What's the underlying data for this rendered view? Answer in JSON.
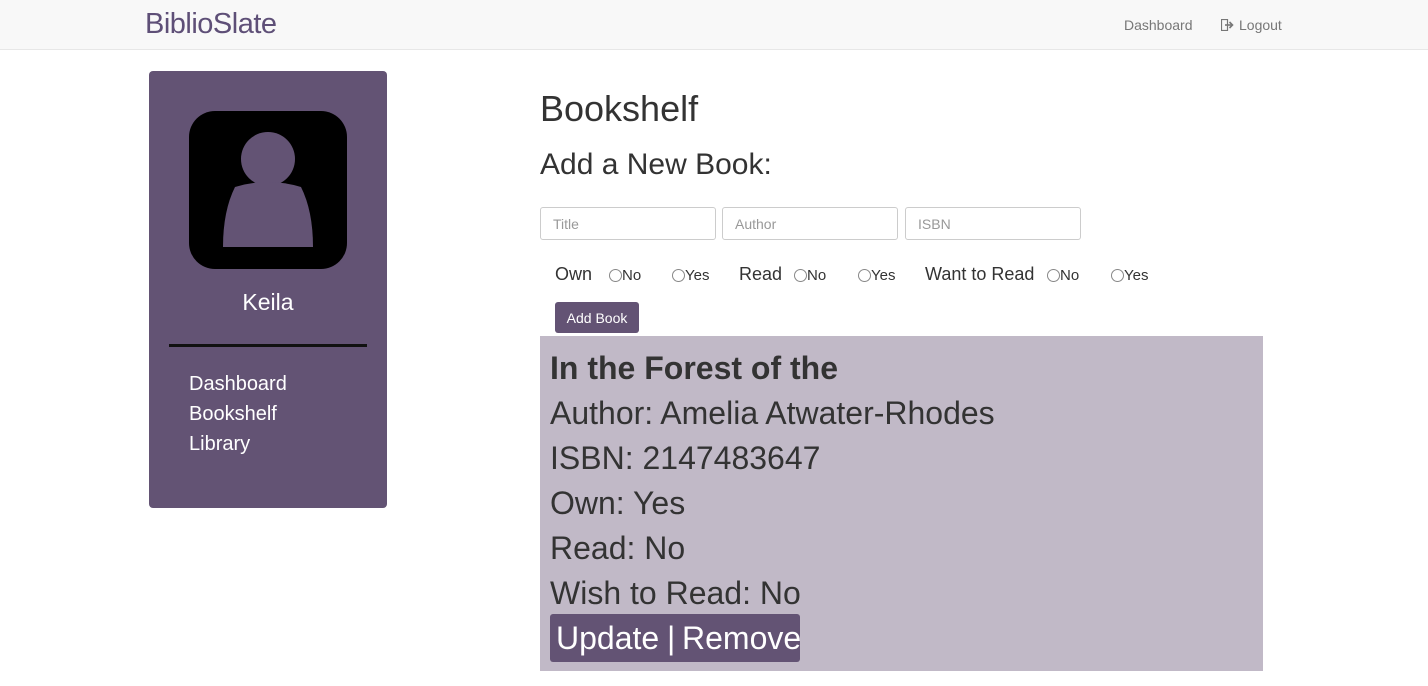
{
  "navbar": {
    "brand": "BiblioSlate",
    "dashboard": "Dashboard",
    "logout": "Logout"
  },
  "sidebar": {
    "username": "Keila",
    "links": [
      "Dashboard",
      "Bookshelf",
      "Library"
    ]
  },
  "main": {
    "page_title": "Bookshelf",
    "section_title": "Add a New Book:",
    "placeholders": {
      "title": "Title",
      "author": "Author",
      "isbn": "ISBN"
    },
    "radio_groups": [
      {
        "label": "Own",
        "no": "No",
        "yes": "Yes"
      },
      {
        "label": "Read",
        "no": "No",
        "yes": "Yes"
      },
      {
        "label": "Want to Read",
        "no": "No",
        "yes": "Yes"
      }
    ],
    "add_button": "Add Book"
  },
  "book": {
    "title": "In the Forest of the",
    "author": "Author: Amelia Atwater-Rhodes",
    "isbn": "ISBN: 2147483647",
    "own": "Own: Yes",
    "read": "Read: No",
    "wish": "Wish to Read: No",
    "update": "Update",
    "separator": "|",
    "remove": "Remove"
  },
  "colors": {
    "brand": "#5e4f77",
    "sidebar": "#635374",
    "card": "#c1b9c7"
  }
}
